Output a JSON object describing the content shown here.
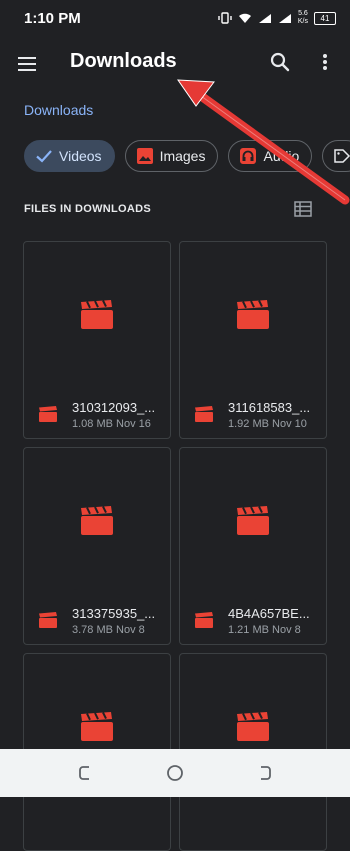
{
  "status_bar": {
    "time": "1:10 PM",
    "network_speed_value": "5.6",
    "network_speed_unit": "K/s",
    "battery": "41"
  },
  "app_bar": {
    "title": "Downloads"
  },
  "breadcrumb": "Downloads",
  "chips": [
    {
      "label": "Videos",
      "selected": true
    },
    {
      "label": "Images",
      "selected": false
    },
    {
      "label": "Audio",
      "selected": false
    }
  ],
  "section_header": "FILES IN DOWNLOADS",
  "files": [
    {
      "name": "310312093_...",
      "meta": "1.08 MB Nov 16"
    },
    {
      "name": "311618583_...",
      "meta": "1.92 MB Nov 10"
    },
    {
      "name": "313375935_...",
      "meta": "3.78 MB Nov 8"
    },
    {
      "name": "4B4A657BE...",
      "meta": "1.21 MB Nov 8"
    },
    {
      "name": "",
      "meta": ""
    },
    {
      "name": "",
      "meta": ""
    }
  ],
  "colors": {
    "background": "#202124",
    "accent": "#8ab4f8",
    "video_red": "#ea4335",
    "annotation_red": "#e53935"
  }
}
